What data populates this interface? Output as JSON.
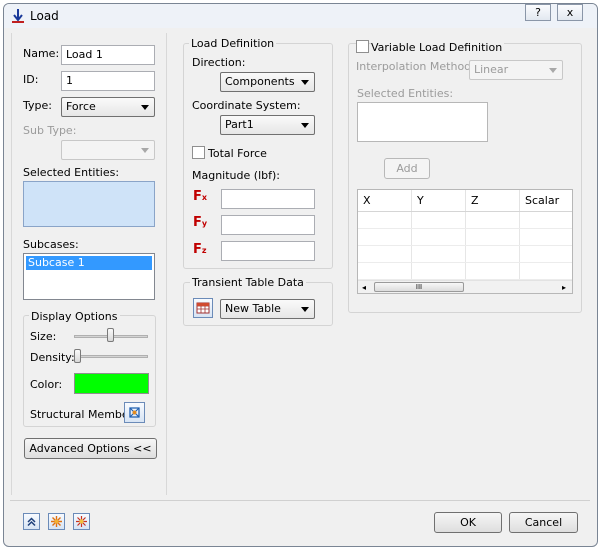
{
  "window": {
    "title": "Load",
    "help_label": "?",
    "close_label": "x"
  },
  "left": {
    "name_label": "Name:",
    "name_value": "Load 1",
    "id_label": "ID:",
    "id_value": "1",
    "type_label": "Type:",
    "type_value": "Force",
    "subtype_label": "Sub Type:",
    "subtype_value": "",
    "selected_entities_label": "Selected Entities:",
    "subcases_label": "Subcases:",
    "subcases": [
      "Subcase 1"
    ],
    "display_options": {
      "title": "Display Options",
      "size_label": "Size:",
      "size_level": 0.49,
      "density_label": "Density:",
      "density_level": 0.0,
      "color_label": "Color:",
      "color": "#00ff00",
      "structural_member_label": "Structural Member"
    },
    "advanced_button": "Advanced Options <<"
  },
  "load_definition": {
    "title": "Load Definition",
    "direction_label": "Direction:",
    "direction_value": "Components",
    "coord_label": "Coordinate System:",
    "coord_value": "Part1",
    "total_force_label": "Total Force",
    "magnitude_label": "Magnitude (lbf):",
    "components": [
      {
        "letter": "F",
        "sub": "x",
        "value": ""
      },
      {
        "letter": "F",
        "sub": "y",
        "value": ""
      },
      {
        "letter": "F",
        "sub": "z",
        "value": ""
      }
    ],
    "component_color": "#c00000"
  },
  "transient": {
    "title": "Transient Table Data",
    "value": "New Table"
  },
  "variable": {
    "checkbox_label": "Variable Load Definition",
    "interp_label": "Interpolation Method:",
    "interp_value": "Linear",
    "selected_entities_label": "Selected Entities:",
    "add_button": "Add",
    "columns": [
      "X",
      "Y",
      "Z",
      "Scalar"
    ],
    "scroll_grip": "III"
  },
  "footer": {
    "ok": "OK",
    "cancel": "Cancel"
  },
  "colors": {
    "selection": "#3399ff",
    "entities_bg": "#cfe3f8"
  }
}
